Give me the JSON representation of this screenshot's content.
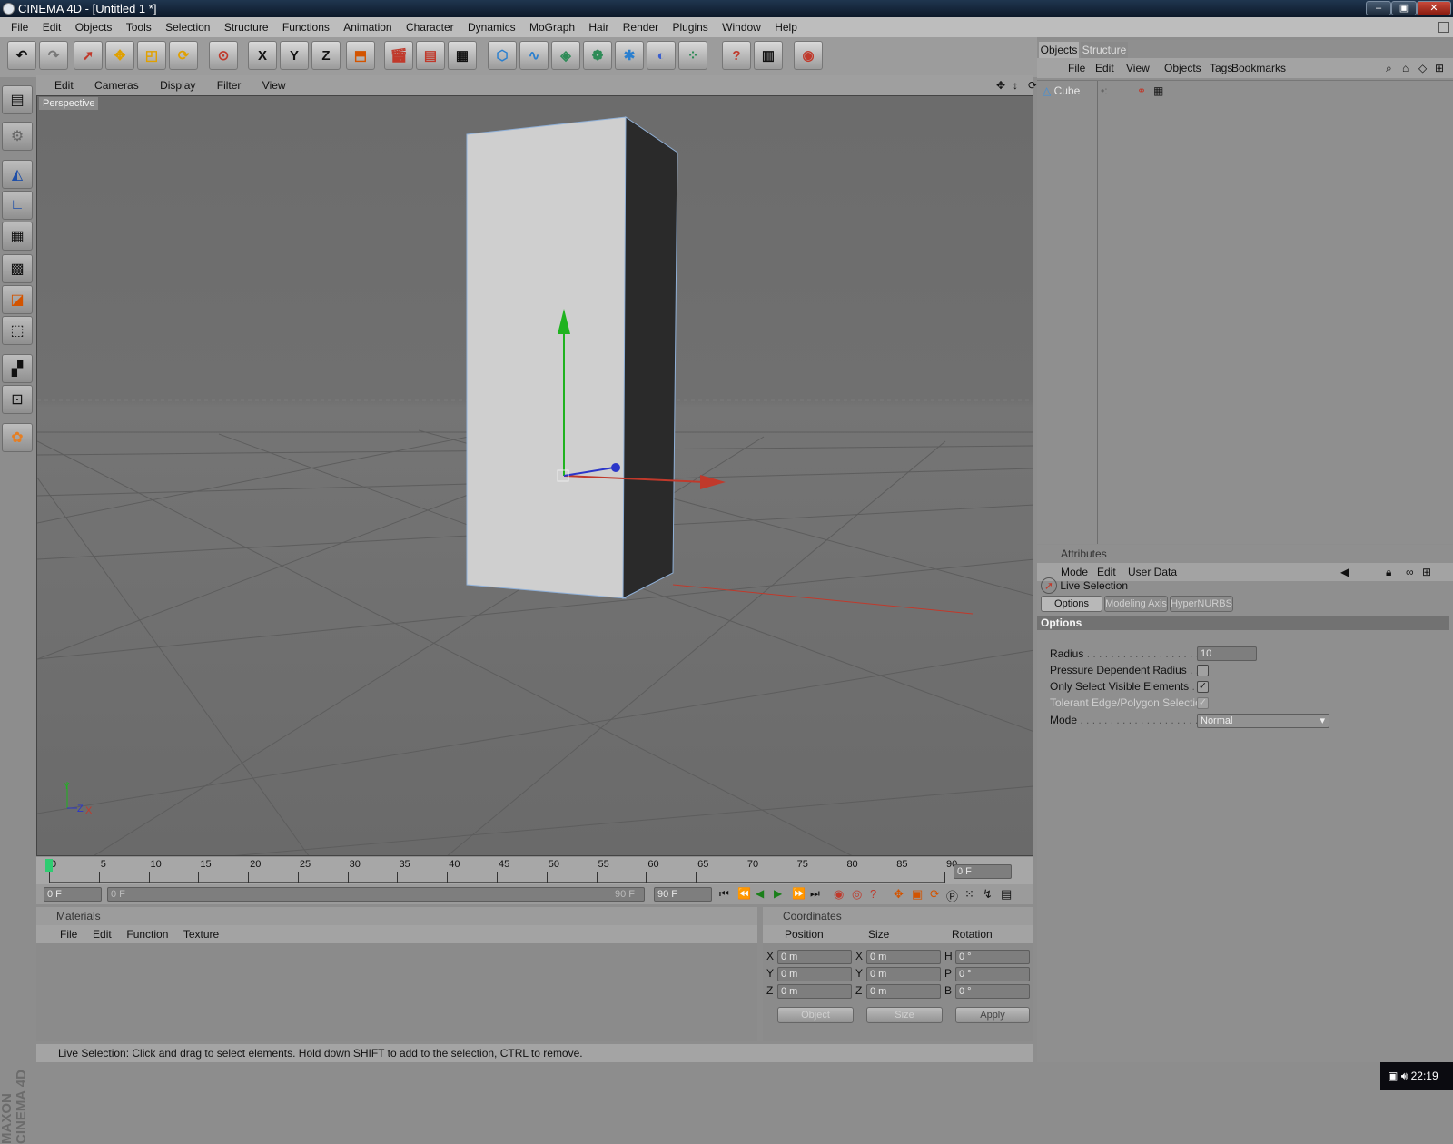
{
  "window": {
    "title": "CINEMA 4D - [Untitled 1 *]"
  },
  "menu": [
    "File",
    "Edit",
    "Objects",
    "Tools",
    "Selection",
    "Structure",
    "Functions",
    "Animation",
    "Character",
    "Dynamics",
    "MoGraph",
    "Hair",
    "Render",
    "Plugins",
    "Window",
    "Help"
  ],
  "toolbar_icons": [
    "undo-icon",
    "redo-icon",
    "live-selection-icon",
    "move-icon",
    "scale-icon",
    "rotate-icon",
    "live-selection-tool-icon",
    "x-axis-lock-icon",
    "y-axis-lock-icon",
    "z-axis-lock-icon",
    "coordinate-system-icon",
    "render-view-icon",
    "render-picture-viewer-icon",
    "render-settings-icon",
    "cube-primitive-icon",
    "spline-icon",
    "nurbs-icon",
    "array-icon",
    "deformer-icon",
    "scene-icon",
    "particles-icon",
    "help-icon",
    "layout-icon",
    "web-icon"
  ],
  "toolbar_axis_labels": {
    "x": "X",
    "y": "Y",
    "z": "Z"
  },
  "viewport": {
    "menu": [
      "Edit",
      "Cameras",
      "Display",
      "Filter",
      "View"
    ],
    "label": "Perspective",
    "axis_labels": {
      "y": "Y",
      "z": "Z",
      "x": "X"
    }
  },
  "timeline": {
    "ticks": [
      "0",
      "5",
      "10",
      "15",
      "20",
      "25",
      "30",
      "35",
      "40",
      "45",
      "50",
      "55",
      "60",
      "65",
      "70",
      "75",
      "80",
      "85",
      "90"
    ],
    "current_frame": "0 F",
    "start_field": "0 F",
    "range_start": "0 F",
    "range_end": "90 F",
    "end_field": "90 F"
  },
  "materials": {
    "title": "Materials",
    "menu": [
      "File",
      "Edit",
      "Function",
      "Texture"
    ]
  },
  "coordinates": {
    "title": "Coordinates",
    "headers": [
      "Position",
      "Size",
      "Rotation"
    ],
    "rows": [
      {
        "pos_axis": "X",
        "pos": "0 m",
        "size_axis": "X",
        "size": "0 m",
        "rot_axis": "H",
        "rot": "0 °"
      },
      {
        "pos_axis": "Y",
        "pos": "0 m",
        "size_axis": "Y",
        "size": "0 m",
        "rot_axis": "P",
        "rot": "0 °"
      },
      {
        "pos_axis": "Z",
        "pos": "0 m",
        "size_axis": "Z",
        "size": "0 m",
        "rot_axis": "B",
        "rot": "0 °"
      }
    ],
    "mode_select": "Object",
    "size_select": "Size",
    "apply": "Apply"
  },
  "status": "Live Selection: Click and drag to select elements. Hold down SHIFT to add to the selection, CTRL to remove.",
  "branding": {
    "line1": "MAXON",
    "line2": "CINEMA 4D"
  },
  "objects_panel": {
    "tabs": [
      "Objects",
      "Structure"
    ],
    "menu": [
      "File",
      "Edit",
      "View",
      "Objects",
      "Tags",
      "Bookmarks"
    ],
    "items": [
      {
        "name": "Cube"
      }
    ]
  },
  "attributes": {
    "title": "Attributes",
    "menu": [
      "Mode",
      "Edit",
      "User Data"
    ],
    "tool_name": "Live Selection",
    "tabs": [
      "Options",
      "Modeling Axis",
      "HyperNURBS"
    ],
    "section": "Options",
    "radius_label": "Radius",
    "radius_value": "10",
    "pressure_label": "Pressure Dependent Radius",
    "visible_label": "Only Select Visible Elements",
    "tolerant_label": "Tolerant Edge/Polygon Selection",
    "mode_label": "Mode",
    "mode_value": "Normal"
  },
  "clock": "22:19",
  "colors": {
    "accent_red": "#c0392b",
    "axis_green": "#1fb31f",
    "axis_blue": "#2b36c9",
    "title_bg": "#0c1828"
  }
}
